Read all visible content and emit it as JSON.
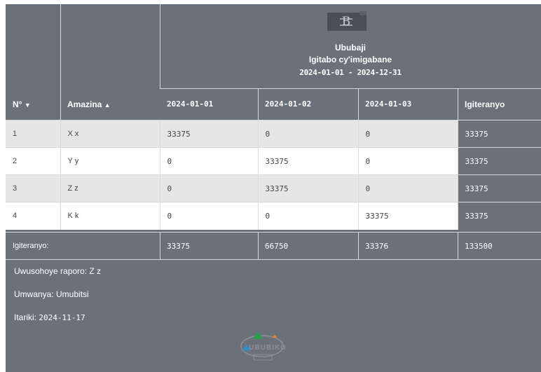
{
  "header": {
    "title": "Ububaji",
    "subtitle": "Igitabo cy'imigabane",
    "period": "2024-01-01 - 2024-12-31"
  },
  "columns": {
    "number": "N°",
    "number_sort": "▼",
    "name": "Amazina",
    "name_sort": "▲",
    "dates": [
      "2024-01-01",
      "2024-01-02",
      "2024-01-03"
    ],
    "total": "Igiteranyo"
  },
  "rows": [
    {
      "n": "1",
      "name": "X x",
      "d1": "33375",
      "d2": "0",
      "d3": "0",
      "total": "33375"
    },
    {
      "n": "2",
      "name": "Y y",
      "d1": "0",
      "d2": "33375",
      "d3": "0",
      "total": "33375"
    },
    {
      "n": "3",
      "name": "Z z",
      "d1": "0",
      "d2": "33375",
      "d3": "0",
      "total": "33375"
    },
    {
      "n": "4",
      "name": "K k",
      "d1": "0",
      "d2": "0",
      "d3": "33375",
      "total": "33375"
    }
  ],
  "totals": {
    "label": "Igiteranyo:",
    "d1": "33375",
    "d2": "66750",
    "d3": "33376",
    "total": "133500"
  },
  "footer": {
    "author": "Uwusohoye raporo: Z z",
    "role": "Umwanya: Umubitsi",
    "date_label": "Itariki:",
    "date_value": "2024-11-17",
    "logo_text": "UBUBIKO"
  },
  "colors": {
    "background": "#6b717b",
    "row_alt": "#e6e6e6",
    "row_plain": "#ffffff",
    "logo_green": "#2e9e4a",
    "logo_blue": "#2a8fd6",
    "logo_orange": "#e3892b"
  }
}
